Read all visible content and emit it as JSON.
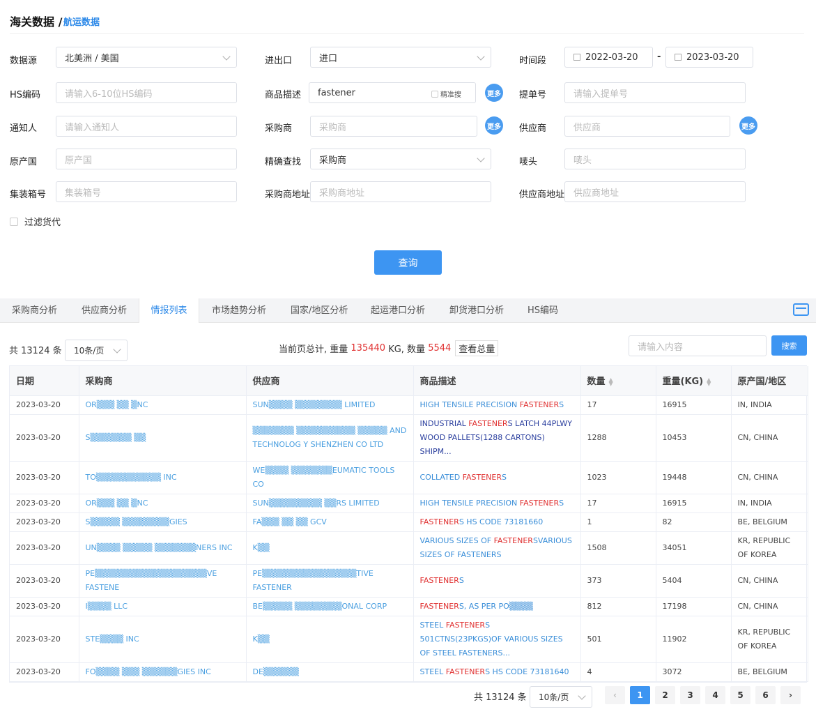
{
  "header": {
    "title": "海关数据 /",
    "subtitle": "航运数据"
  },
  "form": {
    "data_source": {
      "label": "数据源",
      "value": "北美洲 / 美国"
    },
    "import_export": {
      "label": "进出口",
      "value": "进口"
    },
    "period": {
      "label": "时间段",
      "start": "2022-03-20",
      "sep": "-",
      "end": "2023-03-20"
    },
    "hs_code": {
      "label": "HS编码",
      "placeholder": "请输入6-10位HS编码"
    },
    "product_desc": {
      "label": "商品描述",
      "value": "fastener",
      "exact_label": "精准搜"
    },
    "bill_no": {
      "label": "提单号",
      "placeholder": "请输入提单号"
    },
    "notify": {
      "label": "通知人",
      "placeholder": "请输入通知人"
    },
    "buyer": {
      "label": "采购商",
      "placeholder": "采购商"
    },
    "supplier": {
      "label": "供应商",
      "placeholder": "供应商"
    },
    "origin": {
      "label": "原产国",
      "placeholder": "原产国"
    },
    "exact_find": {
      "label": "精确查找",
      "value": "采购商"
    },
    "mark": {
      "label": "唛头",
      "placeholder": "唛头"
    },
    "container": {
      "label": "集装箱号",
      "placeholder": "集装箱号"
    },
    "buyer_addr": {
      "label": "采购商地址",
      "placeholder": "采购商地址"
    },
    "supplier_addr": {
      "label": "供应商地址",
      "placeholder": "供应商地址"
    },
    "filter_forwarder": "过滤货代",
    "more_label": "更多",
    "query_button": "查询"
  },
  "tabs": [
    "采购商分析",
    "供应商分析",
    "情报列表",
    "市场趋势分析",
    "国家/地区分析",
    "起运港口分析",
    "卸货港口分析",
    "HS编码"
  ],
  "active_tab": "情报列表",
  "summary": {
    "total": "共 13124 条",
    "page_size": "10条/页",
    "text_prefix": "当前页总计, 重量",
    "weight": "135440",
    "weight_unit": "KG, 数量",
    "count": "5544",
    "view_total": "查看总量",
    "search_placeholder": "请输入内容",
    "search_button": "搜索"
  },
  "table": {
    "columns": [
      "日期",
      "采购商",
      "供应商",
      "商品描述",
      "数量",
      "重量(KG)",
      "原产国/地区"
    ],
    "rows": [
      {
        "date": "2023-03-20",
        "buyer": "OR▒▒▒ ▒▒ ▒NC",
        "supplier": "SUN▒▒▒▒ ▒▒▒▒▒▒▒▒ LIMITED",
        "desc": [
          "HIGH TENSILE PRECISION ",
          "FASTENER",
          "S"
        ],
        "dark": false,
        "qty": "17",
        "weight": "16915",
        "origin": "IN, INDIA"
      },
      {
        "date": "2023-03-20",
        "buyer": "S▒▒▒▒▒▒▒ ▒▒",
        "supplier": "▒▒▒▒▒▒▒ ▒▒▒▒▒▒▒▒▒▒ ▒▒▒▒▒ AND TECHNOLOG Y SHENZHEN CO LTD",
        "desc": [
          "INDUSTRIAL ",
          "FASTENER",
          "S LATCH 44PLWY WOOD PALLETS(1288 CARTONS) SHIPM..."
        ],
        "dark": true,
        "qty": "1288",
        "weight": "10453",
        "origin": "CN, CHINA"
      },
      {
        "date": "2023-03-20",
        "buyer": "TO▒▒▒▒▒▒▒▒▒▒▒ INC",
        "supplier": "WE▒▒▒▒ ▒▒▒▒▒▒▒EUMATIC TOOLS CO",
        "desc": [
          "COLLATED ",
          "FASTENER",
          "S"
        ],
        "dark": false,
        "qty": "1023",
        "weight": "19448",
        "origin": "CN, CHINA"
      },
      {
        "date": "2023-03-20",
        "buyer": "OR▒▒▒ ▒▒ ▒NC",
        "supplier": "SUN▒▒▒▒▒▒▒▒▒ ▒▒RS LIMITED",
        "desc": [
          "HIGH TENSILE PRECISION ",
          "FASTENER",
          "S"
        ],
        "dark": false,
        "qty": "17",
        "weight": "16915",
        "origin": "IN, INDIA"
      },
      {
        "date": "2023-03-20",
        "buyer": "S▒▒▒▒▒ ▒▒▒▒▒▒▒▒GIES",
        "supplier": "FA▒▒▒ ▒▒ ▒▒ GCV",
        "desc": [
          "",
          "FASTENER",
          "S HS CODE 73181660"
        ],
        "dark": false,
        "qty": "1",
        "weight": "82",
        "origin": "BE, BELGIUM"
      },
      {
        "date": "2023-03-20",
        "buyer": "UN▒▒▒▒ ▒▒▒▒▒ ▒▒▒▒▒▒▒NERS INC",
        "supplier": "K▒▒",
        "desc": [
          "VARIOUS SIZES OF ",
          "FASTENER",
          "SVARIOUS SIZES OF FASTENERS"
        ],
        "dark": false,
        "qty": "1508",
        "weight": "34051",
        "origin": "KR, REPUBLIC OF KOREA"
      },
      {
        "date": "2023-03-20",
        "buyer": "PE▒▒▒▒▒▒▒▒▒▒▒▒▒▒▒▒▒▒▒VE FASTENE",
        "supplier": "PE▒▒▒▒▒▒▒▒▒▒▒▒▒▒▒▒TIVE FASTENER",
        "desc": [
          "",
          "FASTENER",
          "S"
        ],
        "dark": false,
        "qty": "373",
        "weight": "5404",
        "origin": "CN, CHINA"
      },
      {
        "date": "2023-03-20",
        "buyer": "I▒▒▒▒ LLC",
        "supplier": "BE▒▒▒▒▒ ▒▒▒▒▒▒▒▒ONAL CORP",
        "desc": [
          "",
          "FASTENER",
          "S, AS PER PO▒▒▒▒"
        ],
        "dark": false,
        "qty": "812",
        "weight": "17198",
        "origin": "CN, CHINA"
      },
      {
        "date": "2023-03-20",
        "buyer": "STE▒▒▒▒ INC",
        "supplier": "K▒▒",
        "desc": [
          "STEEL ",
          "FASTENER",
          "S 501CTNS(23PKGS)OF VARIOUS SIZES OF STEEL FASTENERS..."
        ],
        "dark": false,
        "qty": "501",
        "weight": "11902",
        "origin": "KR, REPUBLIC OF KOREA"
      },
      {
        "date": "2023-03-20",
        "buyer": "FO▒▒▒▒ ▒▒▒ ▒▒▒▒▒▒GIES INC",
        "supplier": "DE▒▒▒▒▒▒",
        "desc": [
          "STEEL ",
          "FASTENER",
          "S HS CODE 73181640"
        ],
        "dark": false,
        "qty": "4",
        "weight": "3072",
        "origin": "BE, BELGIUM"
      }
    ]
  },
  "pagination": {
    "total": "共 13124 条",
    "page_size": "10条/页",
    "prev": "‹",
    "next": "›",
    "pages": [
      "1",
      "2",
      "3",
      "4",
      "5",
      "6"
    ],
    "current": "1"
  }
}
